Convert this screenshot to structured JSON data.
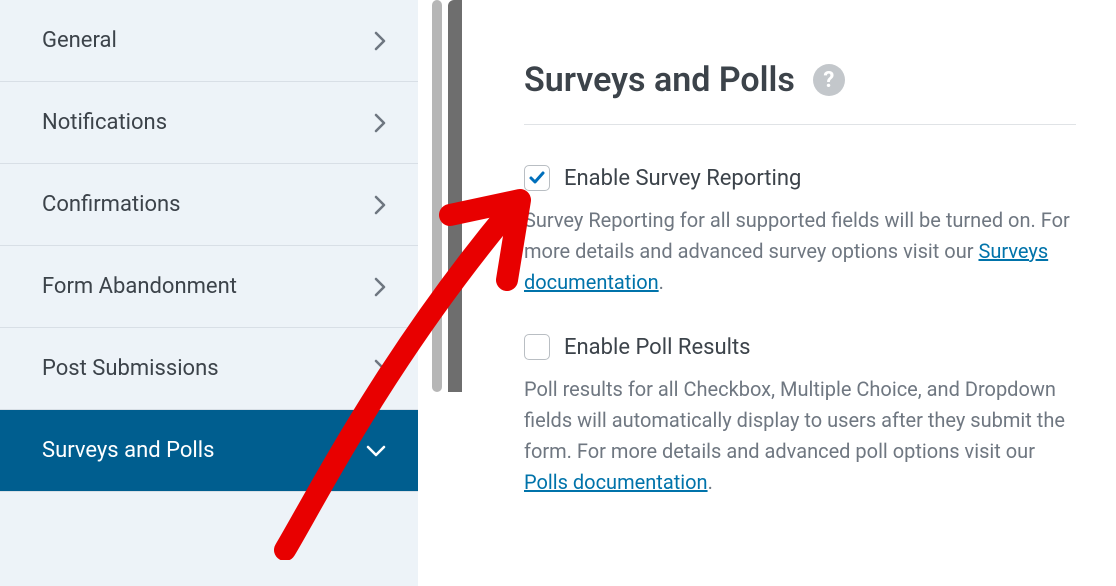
{
  "sidebar": {
    "items": [
      {
        "label": "General"
      },
      {
        "label": "Notifications"
      },
      {
        "label": "Confirmations"
      },
      {
        "label": "Form Abandonment"
      },
      {
        "label": "Post Submissions"
      },
      {
        "label": "Surveys and Polls"
      }
    ]
  },
  "panel": {
    "title": "Surveys and Polls",
    "help_glyph": "?",
    "option1": {
      "label": "Enable Survey Reporting",
      "desc_prefix": "Survey Reporting for all supported fields will be turned on. For more details and advanced survey options visit our ",
      "link_text": "Surveys documentation",
      "desc_suffix": "."
    },
    "option2": {
      "label": "Enable Poll Results",
      "desc_prefix": "Poll results for all Checkbox, Multiple Choice, and Dropdown fields will automatically display to users after they submit the form. For more details and advanced poll options visit our ",
      "link_text": "Polls documentation",
      "desc_suffix": "."
    }
  }
}
